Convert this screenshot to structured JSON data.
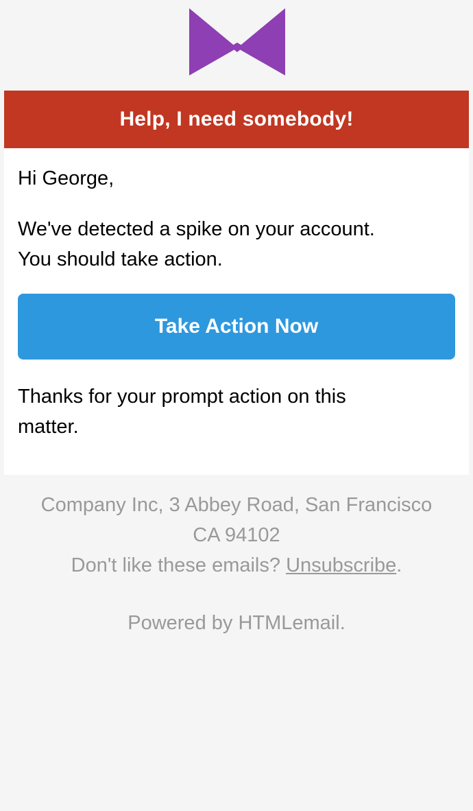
{
  "header": {
    "logo_icon": "purple-bowtie-logo",
    "brand_color": "#8e3fb3"
  },
  "email": {
    "banner_text": "Help, I need somebody!",
    "banner_color": "#c13722",
    "greeting": "Hi George,",
    "message_line1": "We've detected a spike on your account.",
    "message_line2": "You should take action.",
    "cta_label": "Take Action Now",
    "cta_color": "#2e98de",
    "thanks_line1": "Thanks for your prompt action on this",
    "thanks_line2": "matter."
  },
  "footer": {
    "address_line1": "Company Inc, 3 Abbey Road, San Francisco",
    "address_line2": "CA 94102",
    "unsubscribe_prompt": "Don't like these emails?",
    "unsubscribe_link": "Unsubscribe",
    "unsubscribe_suffix": ".",
    "powered_by_prefix": "Powered by",
    "powered_by_link": "HTMLemail",
    "powered_by_suffix": "."
  }
}
